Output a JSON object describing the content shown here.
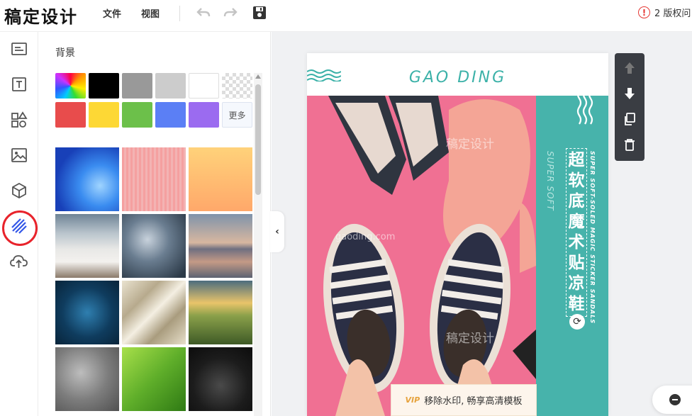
{
  "app": {
    "logo": "稿定设计"
  },
  "menu": {
    "file": "文件",
    "view": "视图"
  },
  "toolbar": {
    "undo": "undo-icon",
    "redo": "redo-icon",
    "save": "save-icon"
  },
  "warning": {
    "icon": "!",
    "text": "2 版权问"
  },
  "rail": {
    "items": [
      "layout",
      "text",
      "elements",
      "image",
      "3d",
      "background",
      "upload"
    ],
    "active": "background"
  },
  "panel": {
    "title": "背景",
    "colors": [
      "rainbow",
      "#000000",
      "#999999",
      "#cccccc",
      "#ffffff",
      "transparent",
      "#e84c4c",
      "#fdd835",
      "#6cc04a",
      "#5b7ff5",
      "#9b6bf0"
    ],
    "more_label": "更多",
    "thumbnails": [
      "blue-abstract",
      "pink-texture",
      "peach-gradient",
      "misty-mountains",
      "storm-clouds",
      "sunset-lake",
      "blue-network",
      "silk-fabric",
      "sunrise-fields",
      "grey-clouds",
      "green-leaf",
      "night-planet"
    ]
  },
  "canvas": {
    "brand": "GAO DING",
    "title": "超软底魔术贴凉鞋",
    "subtitle_vertical": "SUPER SOFT",
    "subtitle_small": "SUPER SOFT-SOLED MAGIC STICKER SANDALS",
    "watermark_cn": "稿定设计",
    "watermark_url": "gaoding.com",
    "vip_badge": "VIP",
    "vip_text": "移除水印, 畅享高清模板"
  },
  "float_toolbar": [
    "move-up-icon",
    "move-down-icon",
    "copy-icon",
    "delete-icon"
  ]
}
